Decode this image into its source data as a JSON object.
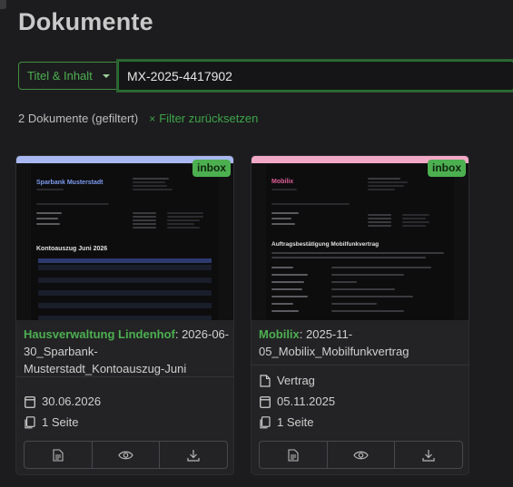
{
  "page": {
    "title": "Dokumente"
  },
  "search": {
    "scope_label": "Titel & Inhalt",
    "query": "MX-2025-4417902"
  },
  "filter": {
    "count_label": "2 Dokumente (gefiltert)",
    "reset_label": "Filter zurücksetzen"
  },
  "colors": {
    "accent": "#4caf50",
    "card1_stripe": "#a9b8f0",
    "card2_stripe": "#f2a9c7"
  },
  "documents": [
    {
      "badge": "inbox",
      "correspondent": "Hausverwaltung Lindenhof",
      "title": ": 2026-06-30_Sparbank-Musterstadt_Kontoauszug-Juni",
      "document_type": "",
      "date": "30.06.2026",
      "pages": "1 Seite",
      "preview": {
        "brand": "Sparbank Musterstadt",
        "heading": "Kontoauszug Juni 2026"
      },
      "actions": [
        "details-icon",
        "view-icon",
        "download-icon"
      ]
    },
    {
      "badge": "inbox",
      "correspondent": "Mobilix",
      "title": ": 2025-11-05_Mobilix_Mobilfunkvertrag",
      "document_type": "Vertrag",
      "date": "05.11.2025",
      "pages": "1 Seite",
      "preview": {
        "brand": "Mobilix",
        "heading": "Auftragsbestätigung Mobilfunkvertrag"
      },
      "actions": [
        "details-icon",
        "view-icon",
        "download-icon"
      ]
    }
  ]
}
